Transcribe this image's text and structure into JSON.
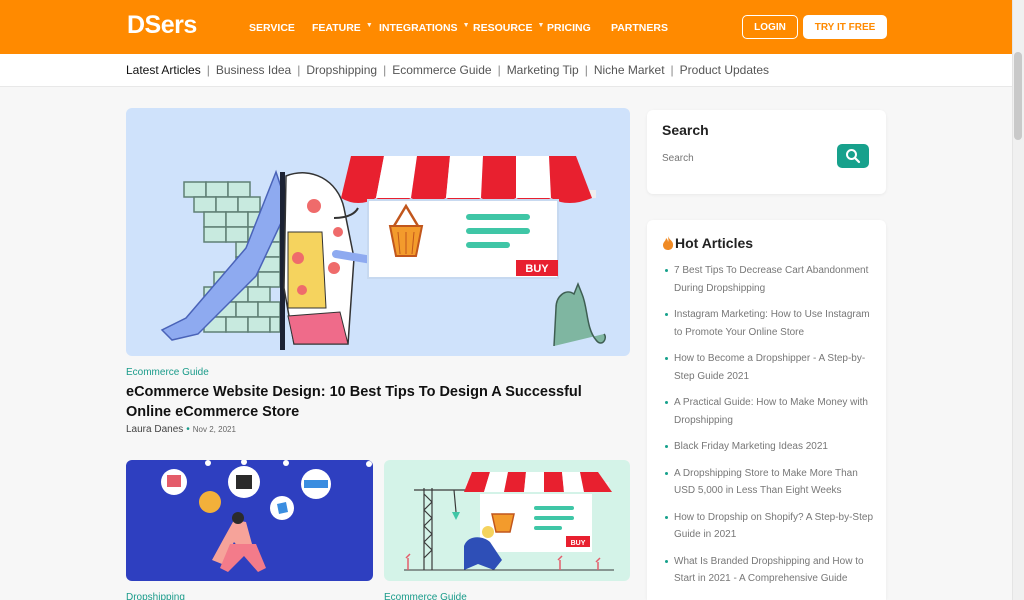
{
  "header": {
    "logo": "DSers",
    "nav": [
      {
        "label": "SERVICE",
        "has_dropdown": false
      },
      {
        "label": "FEATURE",
        "has_dropdown": true
      },
      {
        "label": "INTEGRATIONS",
        "has_dropdown": true
      },
      {
        "label": "RESOURCE",
        "has_dropdown": true
      },
      {
        "label": "PRICING",
        "has_dropdown": false
      },
      {
        "label": "PARTNERS",
        "has_dropdown": false
      }
    ],
    "login_label": "LOGIN",
    "try_label": "TRY IT FREE",
    "brand_color": "#ff8a00"
  },
  "categories": [
    "Latest Articles",
    "Business Idea",
    "Dropshipping",
    "Ecommerce Guide",
    "Marketing Tip",
    "Niche Market",
    "Product Updates"
  ],
  "featured": {
    "tag": "Ecommerce Guide",
    "title": "eCommerce Website Design: 10 Best Tips To Design A Successful Online eCommerce Store",
    "author": "Laura Danes",
    "date": "Nov 2, 2021",
    "badge_text": "BUY"
  },
  "cards": [
    {
      "tag": "Dropshipping"
    },
    {
      "tag": "Ecommerce Guide",
      "badge_text": "BUY"
    }
  ],
  "sidebar": {
    "search_title": "Search",
    "search_placeholder": "Search",
    "hot_title": "Hot Articles",
    "hot_articles": [
      "7 Best Tips To Decrease Cart Abandonment During Dropshipping",
      "Instagram Marketing: How to Use Instagram to Promote Your Online Store",
      "How to Become a Dropshipper - A Step-by-Step Guide 2021",
      "A Practical Guide: How to Make Money with Dropshipping",
      "Black Friday Marketing Ideas 2021",
      "A Dropshipping Store to Make More Than USD 5,000 in Less Than Eight Weeks",
      "How to Dropship on Shopify? A Step-by-Step Guide in 2021",
      "What Is Branded Dropshipping and How to Start in 2021 - A Comprehensive Guide"
    ]
  },
  "accent_color": "#17a18c"
}
